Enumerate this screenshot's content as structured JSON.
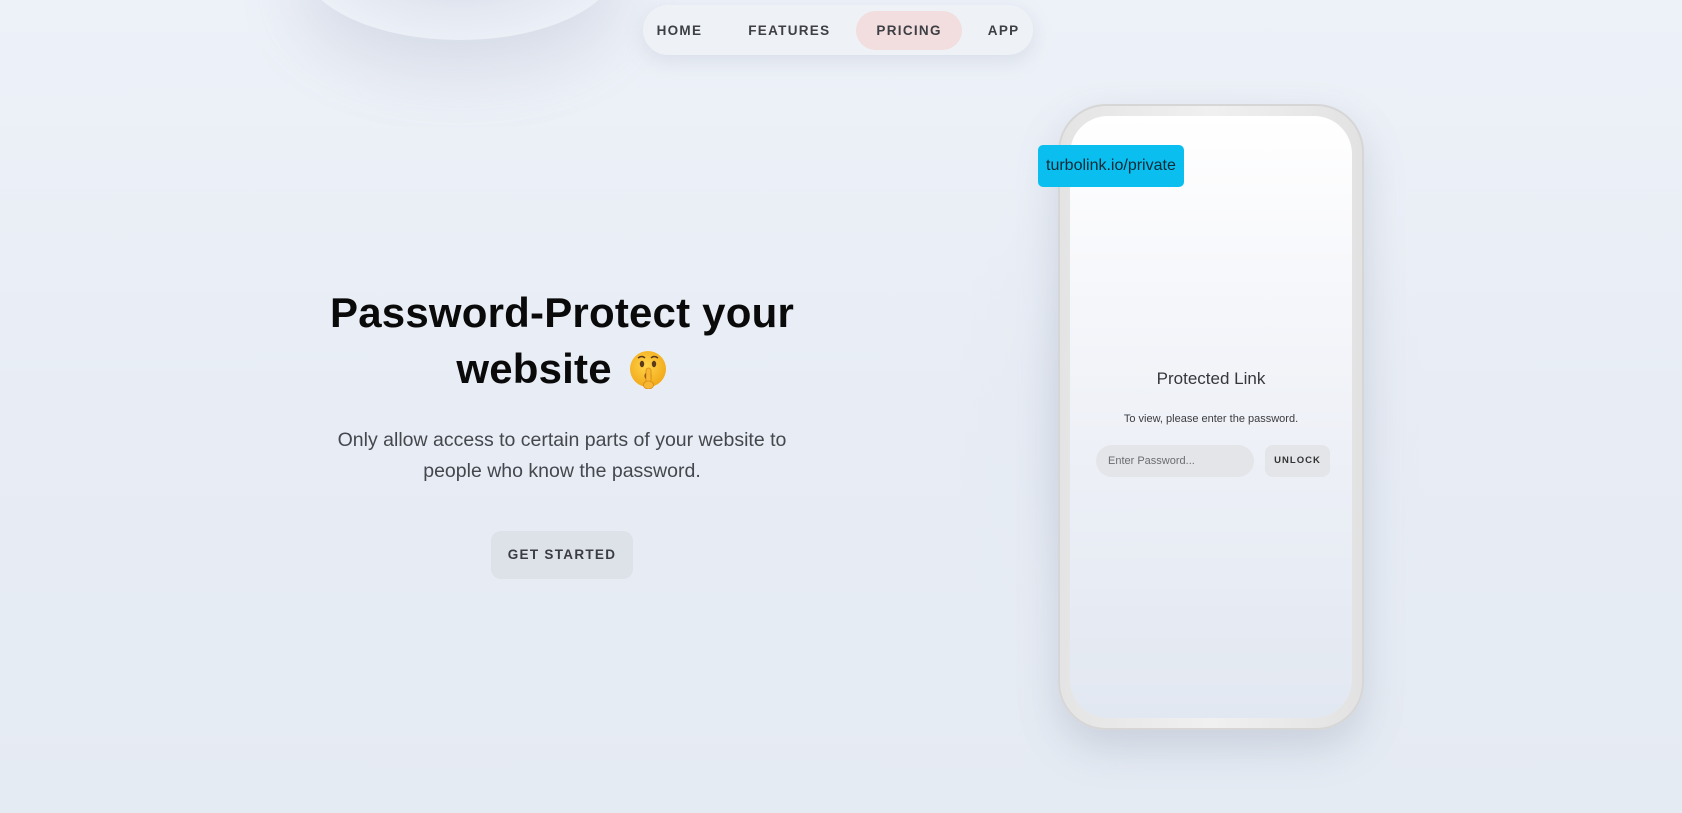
{
  "nav": {
    "items": [
      {
        "label": "HOME",
        "active": false
      },
      {
        "label": "FEATURES",
        "active": false
      },
      {
        "label": "PRICING",
        "active": true
      },
      {
        "label": "APP",
        "active": false
      }
    ]
  },
  "hero": {
    "title_line1": "Password-Protect your",
    "title_line2": "website",
    "emoji_icon": "shushing-face-icon",
    "subtitle": "Only allow access to certain parts of your website to people who know the password.",
    "cta_label": "GET STARTED"
  },
  "phone": {
    "url_badge": "turbolink.io/private",
    "title": "Protected Link",
    "instructions": "To view, please enter the password.",
    "password_placeholder": "Enter Password...",
    "unlock_label": "UNLOCK"
  },
  "colors": {
    "background": "#e8edf5",
    "nav_active": "#f2dede",
    "badge": "#0abff0"
  }
}
